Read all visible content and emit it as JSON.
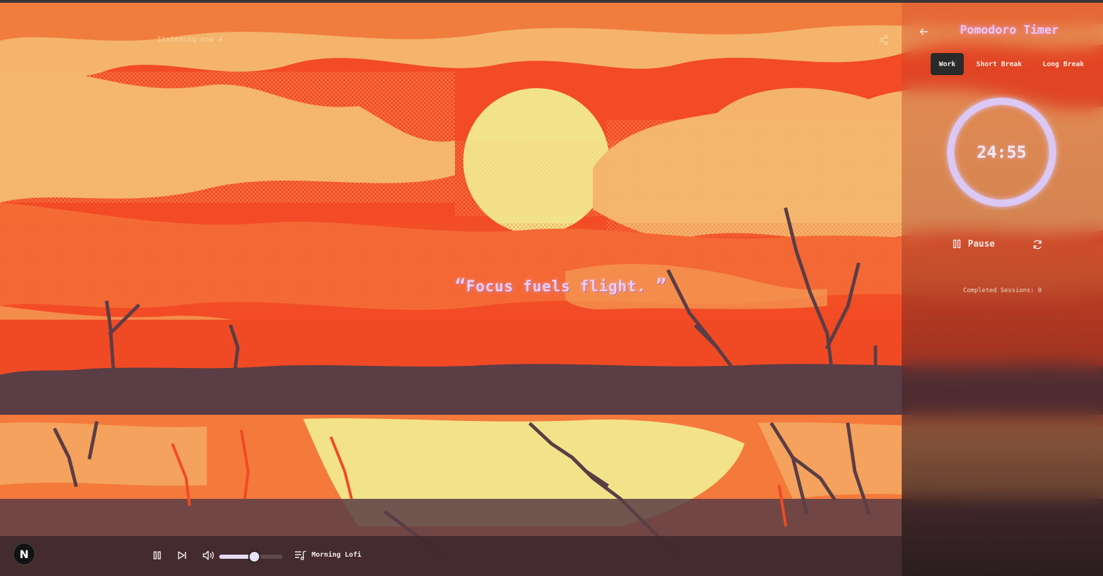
{
  "scene": {
    "listening_label": "listening now 4",
    "quote_open": "“",
    "quote_text": "Focus fuels flight. ",
    "quote_close": "”"
  },
  "player": {
    "logo_letter": "N",
    "track_name": "Morning Lofi",
    "volume_percent": 55
  },
  "pomodoro": {
    "title": "Pomodoro Timer",
    "tabs": [
      {
        "label": "Work",
        "active": true
      },
      {
        "label": "Short Break",
        "active": false
      },
      {
        "label": "Long Break",
        "active": false
      }
    ],
    "time_remaining": "24:55",
    "progress_fraction": 1.0,
    "pause_label": "Pause",
    "sessions_text": "Completed Sessions: 0"
  },
  "colors": {
    "sky_red": "#f24b25",
    "sky_orange": "#f47a3c",
    "cloud_light": "#f4b46b",
    "sun_yellow": "#f2e38a",
    "shore_dark": "#5b3d45",
    "timer_ring": "#dcc8f5"
  }
}
